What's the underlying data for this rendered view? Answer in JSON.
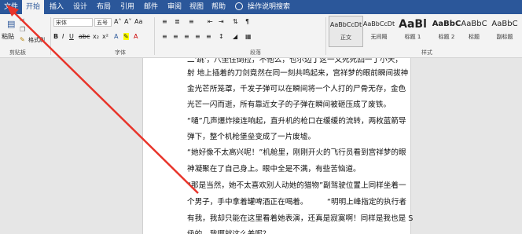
{
  "tabs": [
    "文件",
    "开始",
    "插入",
    "设计",
    "布局",
    "引用",
    "邮件",
    "审阅",
    "视图",
    "帮助"
  ],
  "tell_me": "操作说明搜索",
  "clipboard": {
    "cut": "剪切",
    "paste": "粘贴",
    "format_painter": "格式刷",
    "group_label": "剪贴板"
  },
  "font": {
    "name": "宋体",
    "size": "五号",
    "group_label": "字体"
  },
  "paragraph": {
    "group_label": "段落"
  },
  "styles": {
    "group_label": "样式",
    "items": [
      {
        "preview": "AaBbCcDt",
        "name": "正文"
      },
      {
        "preview": "AaBbCcDt",
        "name": "无间隔"
      },
      {
        "preview": "AaBl",
        "name": "标题 1"
      },
      {
        "preview": "AaBbC",
        "name": "标题 2"
      },
      {
        "preview": "AaBbC",
        "name": "标题"
      },
      {
        "preview": "AaBbC",
        "name": "副标题"
      }
    ]
  },
  "document": {
    "lines": [
      "二'跳'，八坐住倒拉，不他么，也尔边丁这一乂死死回一丁小天，",
      "射  地上插着的刀剑竟然在同一刻共鸣起来，宫祥梦的眼前瞬间拔神",
      "金光芒所笼罩，千发子弹可以在瞬间将一个人打的尸骨无存，金色",
      "光芒一闪而逝，所有靠近女子的子弹在瞬间被砸压成了废铁。",
      "“嗵”几声爆炸接连响起，直升机的枪口在缓缓的流转，两枚蓝箭导",
      "弹下，整个机枪堡垒变成了一片废墟。",
      "“她好像不太高兴呢！”机舱里，刚刚开火的飞行员看到宫祥梦的眼",
      "神凝聚在了自己身上。眼中全是不满，有些苦恼道。",
      "“那是当然，她不太喜欢别人动她的猎物”副驾驶位置上同样坐着一",
      "个男子，手中拿着罐啤酒正在喝着。",
      "“明明上峰指定的执行者",
      "有我，我却只能在这里看着她表演，还真是寂寞啊！同样是我也是 S",
      "级的，我哪就这么差呢？"
    ]
  }
}
